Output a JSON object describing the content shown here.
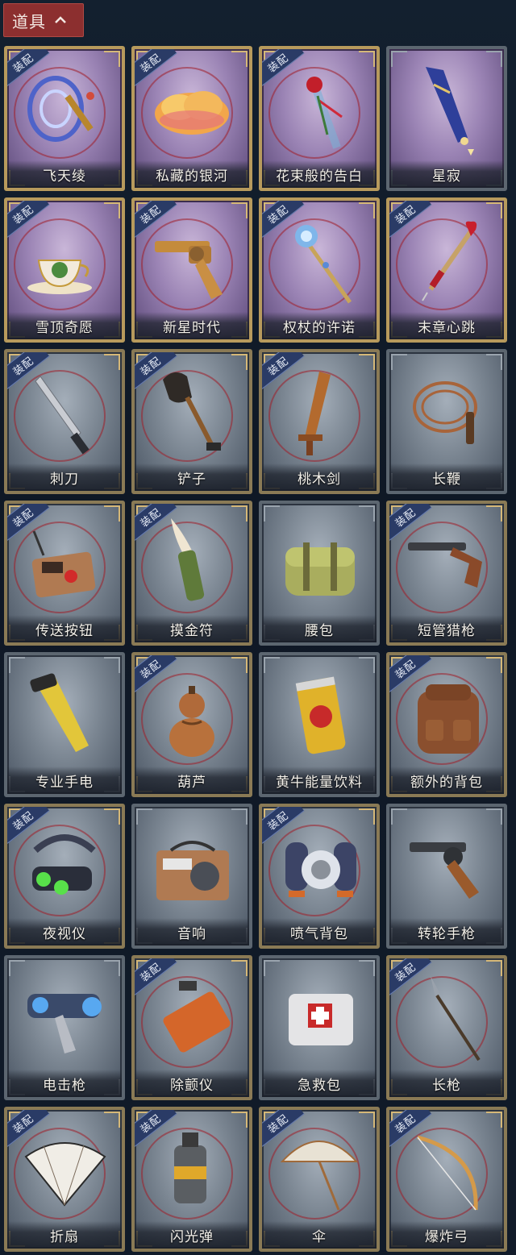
{
  "header": {
    "title": "道具"
  },
  "equip_badge_label": "装配",
  "colors": {
    "header_tab": "#8c2f2f",
    "rare_frame": "#9a83b4",
    "common_frame": "#7a8591",
    "badge": "#2a3b66"
  },
  "items": [
    {
      "name": "飞天绫",
      "rarity": "purple",
      "equipped": true,
      "icon": "ribbon-icon"
    },
    {
      "name": "私藏的银河",
      "rarity": "purple",
      "equipped": true,
      "icon": "galaxy-cloud-icon"
    },
    {
      "name": "花束般的告白",
      "rarity": "purple",
      "equipped": true,
      "icon": "rose-bouquet-icon"
    },
    {
      "name": "星寂",
      "rarity": "purple",
      "equipped": false,
      "icon": "star-scepter-icon"
    },
    {
      "name": "雪顶奇愿",
      "rarity": "purple",
      "equipped": true,
      "icon": "teacup-icon"
    },
    {
      "name": "新星时代",
      "rarity": "purple",
      "equipped": true,
      "icon": "golden-revolver-icon"
    },
    {
      "name": "权杖的许诺",
      "rarity": "purple",
      "equipped": true,
      "icon": "crystal-scepter-icon"
    },
    {
      "name": "末章心跳",
      "rarity": "purple",
      "equipped": true,
      "icon": "heart-syringe-icon"
    },
    {
      "name": "刺刀",
      "rarity": "grey",
      "equipped": true,
      "icon": "bayonet-icon"
    },
    {
      "name": "铲子",
      "rarity": "grey",
      "equipped": true,
      "icon": "shovel-icon"
    },
    {
      "name": "桃木剑",
      "rarity": "grey",
      "equipped": true,
      "icon": "wooden-sword-icon"
    },
    {
      "name": "长鞭",
      "rarity": "grey",
      "equipped": false,
      "icon": "whip-icon"
    },
    {
      "name": "传送按钮",
      "rarity": "grey",
      "equipped": true,
      "icon": "teleport-button-icon"
    },
    {
      "name": "摸金符",
      "rarity": "grey",
      "equipped": true,
      "icon": "talisman-tooth-icon"
    },
    {
      "name": "腰包",
      "rarity": "grey",
      "equipped": false,
      "icon": "waist-bag-icon"
    },
    {
      "name": "短管猎枪",
      "rarity": "grey",
      "equipped": true,
      "icon": "shotgun-icon"
    },
    {
      "name": "专业手电",
      "rarity": "grey",
      "equipped": false,
      "icon": "flashlight-icon"
    },
    {
      "name": "葫芦",
      "rarity": "grey",
      "equipped": true,
      "icon": "gourd-icon"
    },
    {
      "name": "黄牛能量饮料",
      "rarity": "grey",
      "equipped": false,
      "icon": "energy-drink-icon"
    },
    {
      "name": "额外的背包",
      "rarity": "grey",
      "equipped": true,
      "icon": "backpack-icon"
    },
    {
      "name": "夜视仪",
      "rarity": "grey",
      "equipped": true,
      "icon": "night-vision-icon"
    },
    {
      "name": "音响",
      "rarity": "grey",
      "equipped": false,
      "icon": "radio-icon"
    },
    {
      "name": "喷气背包",
      "rarity": "grey",
      "equipped": true,
      "icon": "jetpack-icon"
    },
    {
      "name": "转轮手枪",
      "rarity": "grey",
      "equipped": false,
      "icon": "revolver-icon"
    },
    {
      "name": "电击枪",
      "rarity": "grey",
      "equipped": false,
      "icon": "stun-gun-icon"
    },
    {
      "name": "除颤仪",
      "rarity": "grey",
      "equipped": true,
      "icon": "defibrillator-icon"
    },
    {
      "name": "急救包",
      "rarity": "grey",
      "equipped": false,
      "icon": "first-aid-kit-icon"
    },
    {
      "name": "长枪",
      "rarity": "grey",
      "equipped": true,
      "icon": "spear-icon"
    },
    {
      "name": "折扇",
      "rarity": "grey",
      "equipped": true,
      "icon": "folding-fan-icon"
    },
    {
      "name": "闪光弹",
      "rarity": "grey",
      "equipped": true,
      "icon": "flashbang-icon"
    },
    {
      "name": "伞",
      "rarity": "grey",
      "equipped": true,
      "icon": "umbrella-icon"
    },
    {
      "name": "爆炸弓",
      "rarity": "grey",
      "equipped": true,
      "icon": "bow-icon"
    }
  ]
}
